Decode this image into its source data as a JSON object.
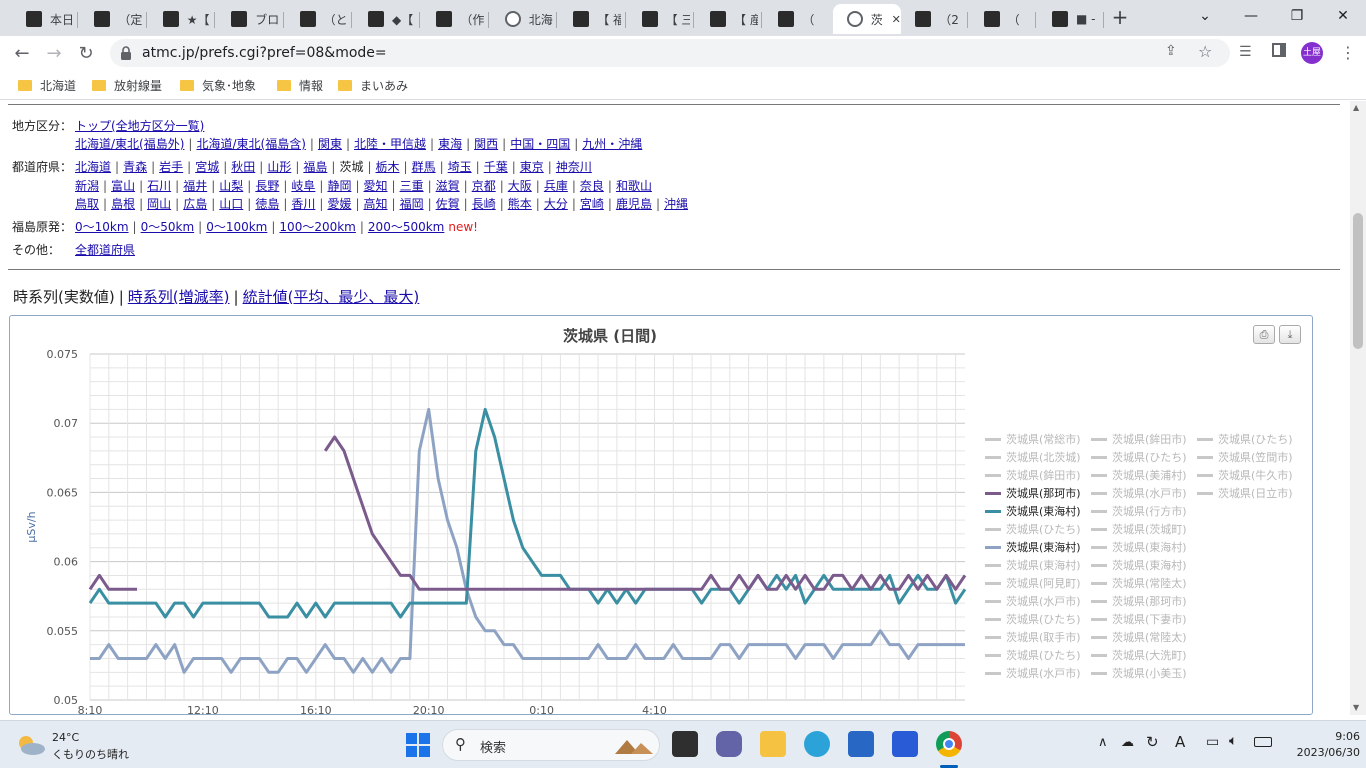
{
  "tabs": [
    {
      "label": "本日",
      "icon": "site-icon"
    },
    {
      "label": "（定",
      "icon": "site-icon"
    },
    {
      "label": "★【",
      "icon": "site-icon"
    },
    {
      "label": "ブログ",
      "icon": "info-icon"
    },
    {
      "label": "（とり",
      "icon": "site-icon"
    },
    {
      "label": "◆【",
      "icon": "site-icon"
    },
    {
      "label": "（作",
      "icon": "site-icon"
    },
    {
      "label": "北海",
      "icon": "globe-icon"
    },
    {
      "label": "【 福",
      "icon": "site-icon"
    },
    {
      "label": "【 三",
      "icon": "site-icon"
    },
    {
      "label": "【 産",
      "icon": "site-icon"
    },
    {
      "label": "（",
      "icon": "site-icon"
    },
    {
      "label": "茨",
      "icon": "globe-icon",
      "active": true
    },
    {
      "label": "（2",
      "icon": "site-icon"
    },
    {
      "label": "（",
      "icon": "site-icon"
    },
    {
      "label": "■ -",
      "icon": "site-icon"
    }
  ],
  "toolbar": {
    "url": "atmc.jp/prefs.cgi?pref=08&mode=",
    "profile": "土屋"
  },
  "bookmarks": [
    "北海道",
    "放射線量",
    "気象･地象",
    "情報",
    "まいあみ"
  ],
  "nav": {
    "region_label": "地方区分：",
    "region_top": "トップ(全地方区分一覧)",
    "regions": [
      "北海道/東北(福島外)",
      "北海道/東北(福島含)",
      "関東",
      "北陸・甲信越",
      "東海",
      "関西",
      "中国・四国",
      "九州・沖縄"
    ],
    "pref_label": "都道府県：",
    "prefs_row1": [
      "北海道",
      "青森",
      "岩手",
      "宮城",
      "秋田",
      "山形",
      "福島",
      "茨城",
      "栃木",
      "群馬",
      "埼玉",
      "千葉",
      "東京",
      "神奈川"
    ],
    "prefs_row2": [
      "新潟",
      "富山",
      "石川",
      "福井",
      "山梨",
      "長野",
      "岐阜",
      "静岡",
      "愛知",
      "三重",
      "滋賀",
      "京都",
      "大阪",
      "兵庫",
      "奈良",
      "和歌山"
    ],
    "prefs_row3": [
      "鳥取",
      "島根",
      "岡山",
      "広島",
      "山口",
      "徳島",
      "香川",
      "愛媛",
      "高知",
      "福岡",
      "佐賀",
      "長崎",
      "熊本",
      "大分",
      "宮崎",
      "鹿児島",
      "沖縄"
    ],
    "fukushima_label": "福島原発：",
    "fukushima": [
      "0～10km",
      "0～50km",
      "0～100km",
      "100～200km",
      "200～500km"
    ],
    "new_label": "new!",
    "other_label": "その他：",
    "other": "全都道府県"
  },
  "modes": {
    "current": "時系列(実数値)",
    "links": [
      "時系列(増減率)",
      "統計値(平均、最少、最大)"
    ]
  },
  "chart_data": {
    "type": "line",
    "title": "茨城県 (日間)",
    "ylabel": "μSv/h",
    "ylim": [
      0.05,
      0.075
    ],
    "yticks": [
      "0.075",
      "0.07",
      "0.065",
      "0.06",
      "0.055",
      "0.05"
    ],
    "xticks": [
      "8:10",
      "12:10",
      "16:10",
      "20:10",
      "0:10",
      "4:10"
    ],
    "grid": true,
    "legend_position": "right",
    "x_start": "8:10",
    "x_interval_minutes": 20,
    "series": [
      {
        "name": "茨城県(那珂市)",
        "color": "#7b5a8c",
        "highlight": true,
        "values": [
          0.058,
          0.059,
          0.058,
          0.058,
          0.058,
          0.058,
          null,
          null,
          null,
          null,
          null,
          null,
          null,
          null,
          null,
          null,
          null,
          null,
          null,
          null,
          null,
          null,
          null,
          null,
          null,
          0.068,
          0.069,
          0.068,
          0.066,
          0.064,
          0.062,
          0.061,
          0.06,
          0.059,
          0.059,
          0.058,
          0.058,
          0.058,
          0.058,
          0.058,
          0.058,
          0.058,
          0.058,
          0.058,
          0.058,
          0.058,
          0.058,
          0.058,
          0.058,
          0.058,
          0.058,
          0.058,
          0.058,
          0.058,
          0.058,
          0.058,
          0.058,
          0.058,
          0.058,
          0.058,
          0.058,
          0.058,
          0.058,
          0.058,
          0.058,
          0.058,
          0.059,
          0.058,
          0.058,
          0.059,
          0.058,
          0.059,
          0.058,
          0.058,
          0.059,
          0.058,
          0.059,
          0.058,
          0.058,
          0.059,
          0.059,
          0.058,
          0.059,
          0.058,
          0.059,
          0.058,
          0.058,
          0.059,
          0.058,
          0.059,
          0.058,
          0.059,
          0.058,
          0.059
        ]
      },
      {
        "name": "茨城県(東海村)",
        "color": "#3a8fa3",
        "highlight": true,
        "values": [
          0.057,
          0.058,
          0.057,
          0.057,
          0.057,
          0.057,
          0.057,
          0.057,
          0.056,
          0.057,
          0.057,
          0.056,
          0.057,
          0.057,
          0.057,
          0.057,
          0.057,
          0.057,
          0.057,
          0.056,
          0.056,
          0.056,
          0.057,
          0.056,
          0.057,
          0.056,
          0.057,
          0.057,
          0.057,
          0.057,
          0.057,
          0.057,
          0.057,
          0.056,
          0.057,
          0.057,
          0.057,
          0.057,
          0.057,
          0.057,
          0.057,
          0.068,
          0.071,
          0.069,
          0.066,
          0.063,
          0.061,
          0.06,
          0.059,
          0.059,
          0.059,
          0.058,
          0.058,
          0.058,
          0.057,
          0.058,
          0.057,
          0.058,
          0.057,
          0.058,
          0.058,
          0.058,
          0.058,
          0.058,
          0.058,
          0.057,
          0.058,
          0.058,
          0.058,
          0.057,
          0.058,
          0.059,
          0.058,
          0.059,
          0.058,
          0.059,
          0.057,
          0.058,
          0.059,
          0.058,
          0.058,
          0.058,
          0.058,
          0.058,
          0.058,
          0.059,
          0.057,
          0.058,
          0.059,
          0.058,
          0.058,
          0.059,
          0.057,
          0.058
        ]
      },
      {
        "name": "茨城県(東海村)",
        "color": "#8ea3c4",
        "highlight": true,
        "values": [
          0.053,
          0.053,
          0.054,
          0.053,
          0.053,
          0.053,
          0.053,
          0.054,
          0.053,
          0.054,
          0.052,
          0.053,
          0.053,
          0.053,
          0.053,
          0.052,
          0.053,
          0.053,
          0.053,
          0.052,
          0.052,
          0.053,
          0.053,
          0.052,
          0.053,
          0.054,
          0.053,
          0.053,
          0.052,
          0.053,
          0.052,
          0.053,
          0.052,
          0.053,
          0.053,
          0.068,
          0.071,
          0.066,
          0.063,
          0.061,
          0.058,
          0.056,
          0.055,
          0.055,
          0.054,
          0.054,
          0.053,
          0.053,
          0.053,
          0.053,
          0.053,
          0.053,
          0.053,
          0.053,
          0.054,
          0.053,
          0.053,
          0.053,
          0.054,
          0.053,
          0.053,
          0.053,
          0.054,
          0.053,
          0.053,
          0.053,
          0.053,
          0.054,
          0.054,
          0.053,
          0.054,
          0.054,
          0.054,
          0.054,
          0.054,
          0.053,
          0.054,
          0.054,
          0.054,
          0.053,
          0.054,
          0.054,
          0.054,
          0.054,
          0.055,
          0.054,
          0.054,
          0.053,
          0.054,
          0.054,
          0.054,
          0.054,
          0.054,
          0.054
        ]
      }
    ],
    "legend": [
      {
        "name": "茨城県(常総市)",
        "color": "#c8c8c8"
      },
      {
        "name": "茨城県(鉾田市)",
        "color": "#c8c8c8"
      },
      {
        "name": "茨城県(ひたち)",
        "color": "#c8c8c8"
      },
      {
        "name": "茨城県(北茨城)",
        "color": "#c8c8c8"
      },
      {
        "name": "茨城県(ひたち)",
        "color": "#c8c8c8"
      },
      {
        "name": "茨城県(笠間市)",
        "color": "#c8c8c8"
      },
      {
        "name": "茨城県(鉾田市)",
        "color": "#c8c8c8"
      },
      {
        "name": "茨城県(美浦村)",
        "color": "#c8c8c8"
      },
      {
        "name": "茨城県(牛久市)",
        "color": "#c8c8c8"
      },
      {
        "name": "茨城県(那珂市)",
        "color": "#7b5a8c",
        "active": true
      },
      {
        "name": "茨城県(水戸市)",
        "color": "#c8c8c8"
      },
      {
        "name": "茨城県(日立市)",
        "color": "#c8c8c8"
      },
      {
        "name": "茨城県(東海村)",
        "color": "#3a8fa3",
        "active": true
      },
      {
        "name": "茨城県(行方市)",
        "color": "#c8c8c8"
      },
      {
        "name": "茨城県(ひたち)",
        "color": "#c8c8c8"
      },
      {
        "name": "茨城県(茨城町)",
        "color": "#c8c8c8"
      },
      {
        "name": "茨城県(東海村)",
        "color": "#8ea3c4",
        "active": true
      },
      {
        "name": "茨城県(東海村)",
        "color": "#c8c8c8"
      },
      {
        "name": "茨城県(東海村)",
        "color": "#c8c8c8"
      },
      {
        "name": "茨城県(東海村)",
        "color": "#c8c8c8"
      },
      {
        "name": "茨城県(阿見町)",
        "color": "#c8c8c8"
      },
      {
        "name": "茨城県(常陸太)",
        "color": "#c8c8c8"
      },
      {
        "name": "茨城県(水戸市)",
        "color": "#c8c8c8"
      },
      {
        "name": "茨城県(那珂市)",
        "color": "#c8c8c8"
      },
      {
        "name": "茨城県(ひたち)",
        "color": "#c8c8c8"
      },
      {
        "name": "茨城県(下妻市)",
        "color": "#c8c8c8"
      },
      {
        "name": "茨城県(取手市)",
        "color": "#c8c8c8"
      },
      {
        "name": "茨城県(常陸太)",
        "color": "#c8c8c8"
      },
      {
        "name": "茨城県(ひたち)",
        "color": "#c8c8c8"
      },
      {
        "name": "茨城県(大洗町)",
        "color": "#c8c8c8"
      },
      {
        "name": "茨城県(水戸市)",
        "color": "#c8c8c8"
      },
      {
        "name": "茨城県(小美玉)",
        "color": "#c8c8c8"
      }
    ]
  },
  "taskbar": {
    "weather_temp": "24°C",
    "weather_desc": "くもりのち晴れ",
    "search_placeholder": "検索",
    "ime": "A",
    "time": "9:06",
    "date": "2023/06/30"
  }
}
